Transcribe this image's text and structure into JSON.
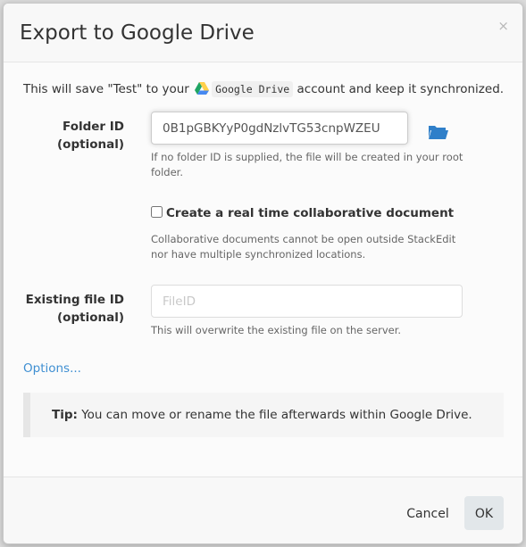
{
  "dialog": {
    "title": "Export to Google Drive",
    "close_label": "×"
  },
  "intro": {
    "before": "This will save \"Test\" to your ",
    "service": "Google Drive",
    "after": " account and keep it synchronized."
  },
  "folder": {
    "label_line1": "Folder ID",
    "label_line2": "(optional)",
    "value": "0B1pGBKYyP0gdNzlvTG53cnpWZEU",
    "help": "If no folder ID is supplied, the file will be created in your root folder."
  },
  "realtime": {
    "label": "Create a real time collaborative document",
    "checked": false,
    "help": "Collaborative documents cannot be open outside StackEdit nor have multiple synchronized locations."
  },
  "existing_file": {
    "label_line1": "Existing file ID",
    "label_line2": "(optional)",
    "placeholder": "FileID",
    "value": "",
    "help": "This will overwrite the existing file on the server."
  },
  "options_link": "Options...",
  "tip": {
    "prefix": "Tip:",
    "text": " You can move or rename the file afterwards within Google Drive."
  },
  "footer": {
    "cancel_label": "Cancel",
    "ok_label": "OK"
  },
  "colors": {
    "link": "#3f8fd2",
    "folder_icon": "#2f7fc9",
    "gdrive_green": "#1fa463",
    "gdrive_yellow": "#ffd04b",
    "gdrive_blue": "#4688f1"
  }
}
